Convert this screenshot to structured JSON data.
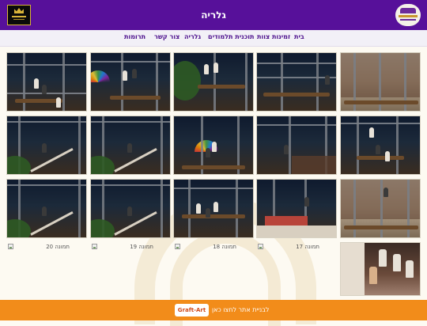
{
  "header": {
    "title": "גלריה"
  },
  "nav": {
    "items": [
      "בית",
      "זמינות צוות",
      "תוכנית תלמודים",
      "גלריה",
      "צור קשר",
      "תרומות"
    ]
  },
  "gallery": {
    "captions": [
      "תמונה 20",
      "תמונה 19",
      "תמונה 18",
      "תמונה 17"
    ]
  },
  "footer": {
    "text": "לבניית אתר לחצו כאן",
    "button": "Graft-Art"
  },
  "colors": {
    "header_bg": "#57109a",
    "nav_text": "#4b0f8c",
    "footer_bg": "#f28c1a"
  },
  "icons": [
    "site-logo-left",
    "site-logo-right",
    "image-placeholder-icon"
  ]
}
